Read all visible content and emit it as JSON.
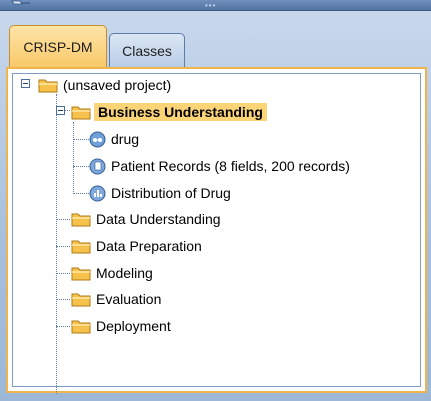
{
  "tabs": [
    {
      "label": "CRISP-DM",
      "active": true
    },
    {
      "label": "Classes",
      "active": false
    }
  ],
  "tree": {
    "root": {
      "label": "(unsaved project)",
      "icon": "folder-icon"
    },
    "phases": [
      {
        "label": "Business Understanding",
        "selected": true,
        "children": [
          {
            "label": "drug",
            "icon": "stream-icon"
          },
          {
            "label": "Patient Records (8 fields, 200 records)",
            "icon": "data-node-icon"
          },
          {
            "label": "Distribution of Drug",
            "icon": "output-node-icon"
          }
        ]
      },
      {
        "label": "Data Understanding"
      },
      {
        "label": "Data Preparation"
      },
      {
        "label": "Modeling"
      },
      {
        "label": "Evaluation"
      },
      {
        "label": "Deployment"
      }
    ]
  },
  "colors": {
    "selection": "#fcd478",
    "tab_active": "#f9c96a",
    "frame": "#f0b44c"
  }
}
